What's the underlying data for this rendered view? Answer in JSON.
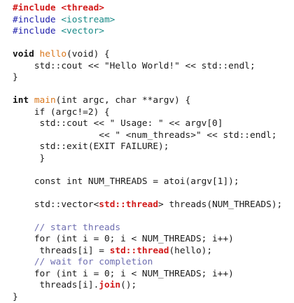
{
  "lines": [
    [
      {
        "t": "#include ",
        "c": "inc-red"
      },
      {
        "t": "<thread>",
        "c": "inc-red"
      }
    ],
    [
      {
        "t": "#include ",
        "c": "pp"
      },
      {
        "t": "<iostream>",
        "c": "inc-teal"
      }
    ],
    [
      {
        "t": "#include ",
        "c": "pp"
      },
      {
        "t": "<vector>",
        "c": "inc-teal"
      }
    ],
    [],
    [
      {
        "t": "void",
        "c": "kw"
      },
      {
        "t": " ",
        "c": "tx"
      },
      {
        "t": "hello",
        "c": "fn"
      },
      {
        "t": "(void) {",
        "c": "tx"
      }
    ],
    [
      {
        "t": "    std::cout << \"Hello World!\" << std::endl;",
        "c": "tx"
      }
    ],
    [
      {
        "t": "}",
        "c": "tx"
      }
    ],
    [],
    [
      {
        "t": "int",
        "c": "kw"
      },
      {
        "t": " ",
        "c": "tx"
      },
      {
        "t": "main",
        "c": "fn"
      },
      {
        "t": "(int argc, char **argv) {",
        "c": "tx"
      }
    ],
    [
      {
        "t": "    if (argc!=2) {",
        "c": "tx"
      }
    ],
    [
      {
        "t": "     std::cout << \" Usage: \" << argv[0]",
        "c": "tx"
      }
    ],
    [
      {
        "t": "                << \" <num_threads>\" << std::endl;",
        "c": "tx"
      }
    ],
    [
      {
        "t": "     std::exit(EXIT FAILURE);",
        "c": "tx"
      }
    ],
    [
      {
        "t": "     }",
        "c": "tx"
      }
    ],
    [],
    [
      {
        "t": "    const int NUM_THREADS = atoi(argv[1]);",
        "c": "tx"
      }
    ],
    [],
    [
      {
        "t": "    std::vector<",
        "c": "tx"
      },
      {
        "t": "std::thread",
        "c": "hl"
      },
      {
        "t": "> threads(NUM_THREADS);",
        "c": "tx"
      }
    ],
    [],
    [
      {
        "t": "    // start threads",
        "c": "cm"
      }
    ],
    [
      {
        "t": "    for (int i = 0; i < NUM_THREADS; i++)",
        "c": "tx"
      }
    ],
    [
      {
        "t": "     threads[i] = ",
        "c": "tx"
      },
      {
        "t": "std::thread",
        "c": "hl"
      },
      {
        "t": "(hello);",
        "c": "tx"
      }
    ],
    [
      {
        "t": "    // wait for completion",
        "c": "cm"
      }
    ],
    [
      {
        "t": "    for (int i = 0; i < NUM_THREADS; i++)",
        "c": "tx"
      }
    ],
    [
      {
        "t": "     threads[i].",
        "c": "tx"
      },
      {
        "t": "join",
        "c": "hl"
      },
      {
        "t": "();",
        "c": "tx"
      }
    ],
    [
      {
        "t": "}",
        "c": "tx"
      }
    ]
  ]
}
